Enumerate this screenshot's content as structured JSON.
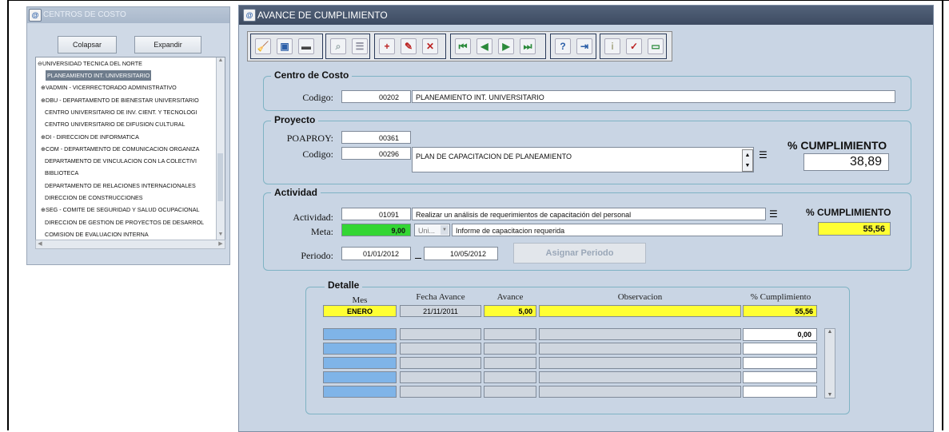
{
  "tree_window": {
    "title": "CENTROS DE COSTO",
    "collapse_label": "Colapsar",
    "expand_label": "Expandir",
    "root": "⊖UNIVERSIDAD TECNICA DEL NORTE",
    "items": [
      {
        "label": "PLANEAMIENTO INT. UNIVERSITARIO",
        "prefix": "",
        "selected": true
      },
      {
        "label": "VADMIN - VICERRECTORADO ADMINISTRATIVO",
        "prefix": "⊕",
        "selected": false
      },
      {
        "label": "DBU - DEPARTAMENTO DE BIENESTAR UNIVERSITARIO",
        "prefix": "⊕",
        "selected": false
      },
      {
        "label": "CENTRO UNIVERSITARIO DE INV. CIENT. Y TECNOLOGI",
        "prefix": "",
        "selected": false
      },
      {
        "label": "CENTRO UNIVERSITARIO DE DIFUSION CULTURAL",
        "prefix": "",
        "selected": false
      },
      {
        "label": "DI - DIRECCION DE INFORMATICA",
        "prefix": "⊕",
        "selected": false
      },
      {
        "label": "COM - DEPARTAMENTO DE COMUNICACION ORGANIZA",
        "prefix": "⊕",
        "selected": false
      },
      {
        "label": "DEPARTAMENTO DE VINCULACION CON LA COLECTIVI",
        "prefix": "",
        "selected": false
      },
      {
        "label": "BIBLIOTECA",
        "prefix": "",
        "selected": false
      },
      {
        "label": "DEPARTAMENTO DE RELACIONES INTERNACIONALES",
        "prefix": "",
        "selected": false
      },
      {
        "label": "DIRECCION DE CONSTRUCCIONES",
        "prefix": "",
        "selected": false
      },
      {
        "label": "SEG - COMITE DE SEGURIDAD Y SALUD OCUPACIONAL",
        "prefix": "⊕",
        "selected": false
      },
      {
        "label": "DIRECCION DE GESTION DE PROYECTOS DE DESARROL",
        "prefix": "",
        "selected": false
      },
      {
        "label": "COMISION DE EVALUACION INTERNA",
        "prefix": "",
        "selected": false
      }
    ]
  },
  "main_window": {
    "title": "AVANCE DE CUMPLIMIENTO",
    "toolbar_icons": [
      "clear-icon",
      "save-icon",
      "print-icon",
      "query-icon",
      "list-icon",
      "insert-record-icon",
      "edit-record-icon",
      "delete-record-icon",
      "first-record-icon",
      "previous-record-icon",
      "next-record-icon",
      "last-record-icon",
      "help-icon",
      "exit-icon",
      "info-icon",
      "check-icon",
      "window-icon"
    ]
  },
  "centro_costo": {
    "section_title": "Centro de Costo",
    "codigo_label": "Codigo:",
    "codigo": "00202",
    "nombre": "PLANEAMIENTO INT. UNIVERSITARIO"
  },
  "proyecto": {
    "section_title": "Proyecto",
    "poaproy_label": "POAPROY:",
    "poaproy": "00361",
    "codigo_label": "Codigo:",
    "codigo": "00296",
    "nombre": "PLAN DE CAPACITACION DE PLANEAMIENTO",
    "cumplimiento_label": "% CUMPLIMIENTO",
    "cumplimiento": "38,89"
  },
  "actividad": {
    "section_title": "Actividad",
    "actividad_label": "Actividad:",
    "codigo": "01091",
    "descripcion": "Realizar un análisis de requerimientos de capacitación  del personal",
    "meta_label": "Meta:",
    "meta": "9,00",
    "unidad": "Uni...",
    "meta_descripcion": "Informe de capacitacion requerida",
    "cumplimiento_label": "% CUMPLIMIENTO",
    "cumplimiento": "55,56",
    "periodo_label": "Periodo:",
    "fecha_inicio": "01/01/2012",
    "fecha_fin": "10/05/2012",
    "asignar_label": "Asignar Periodo"
  },
  "detalle": {
    "section_title": "Detalle",
    "headers": {
      "mes": "Mes",
      "fecha": "Fecha Avance",
      "avance": "Avance",
      "observacion": "Observacion",
      "cumplimiento": "% Cumplimiento"
    },
    "row": {
      "mes": "ENERO",
      "fecha": "21/11/2011",
      "avance": "5,00",
      "observacion": "",
      "cumplimiento": "55,56"
    },
    "total": "0,00"
  },
  "colors": {
    "highlight_yellow": "#ffff33",
    "meta_green": "#33d633",
    "row_blue": "#7fb4e8",
    "title_bar": "#4a586f"
  }
}
